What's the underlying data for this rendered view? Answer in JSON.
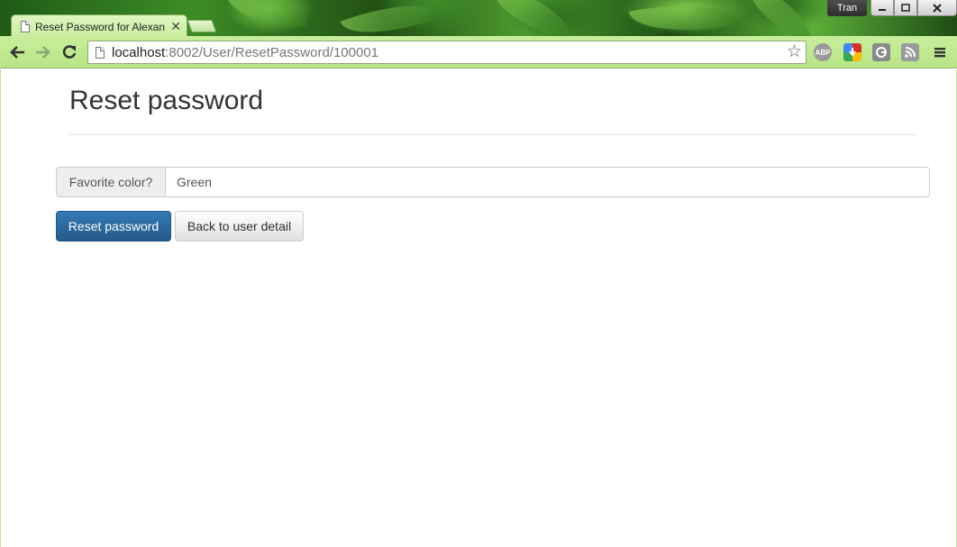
{
  "browser": {
    "tab_title": "Reset Password for Alexan",
    "profile_name": "Tran",
    "url_host": "localhost",
    "url_path": ":8002/User/ResetPassword/100001",
    "extensions": [
      "ABP",
      "",
      "",
      ""
    ]
  },
  "page": {
    "heading": "Reset password",
    "question_label": "Favorite color?",
    "answer_value": "Green",
    "reset_button": "Reset password",
    "back_button": "Back to user detail"
  },
  "colors": {
    "primary": "#337ab7",
    "theme_green": "#b8e487"
  }
}
